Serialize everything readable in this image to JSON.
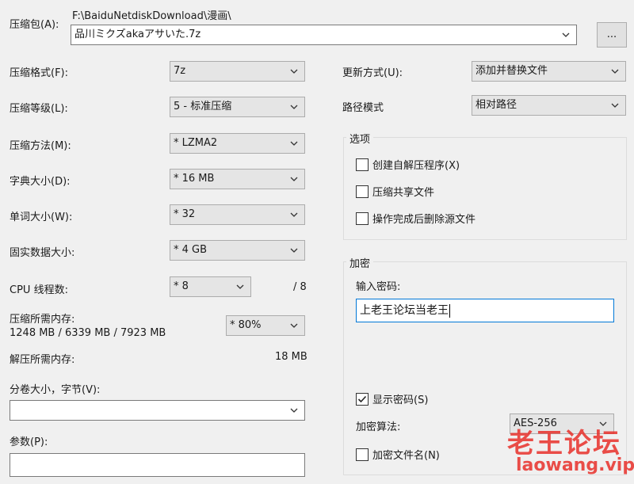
{
  "archive": {
    "label": "压缩包(A):",
    "path": "F:\\BaiduNetdiskDownload\\漫画\\",
    "filename": "品川ミクズakaアサいた.7z",
    "browse_label": "..."
  },
  "left": {
    "format_label": "压缩格式(F):",
    "format_value": "7z",
    "level_label": "压缩等级(L):",
    "level_value": "5 - 标准压缩",
    "method_label": "压缩方法(M):",
    "method_value": "* LZMA2",
    "dict_label": "字典大小(D):",
    "dict_value": "* 16 MB",
    "word_label": "单词大小(W):",
    "word_value": "* 32",
    "solid_label": "固实数据大小:",
    "solid_value": "* 4 GB",
    "threads_label": "CPU 线程数:",
    "threads_value": "* 8",
    "threads_max": "/ 8",
    "mem_comp_label": "压缩所需内存:",
    "mem_comp_value": "1248 MB / 6339 MB / 7923 MB",
    "mem_percent": "* 80%",
    "mem_decomp_label": "解压所需内存:",
    "mem_decomp_value": "18 MB",
    "split_label": "分卷大小，字节(V):",
    "split_value": "",
    "params_label": "参数(P):",
    "params_value": ""
  },
  "right": {
    "update_label": "更新方式(U):",
    "update_value": "添加并替换文件",
    "path_label": "路径模式",
    "path_value": "相对路径",
    "options_title": "选项",
    "options": [
      {
        "label": "创建自解压程序(X)",
        "checked": false
      },
      {
        "label": "压缩共享文件",
        "checked": false
      },
      {
        "label": "操作完成后删除源文件",
        "checked": false
      }
    ],
    "encryption_title": "加密",
    "password_label": "输入密码:",
    "password_value": "上老王论坛当老王",
    "show_password_label": "显示密码(S)",
    "show_password_checked": true,
    "algo_label": "加密算法:",
    "algo_value": "AES-256",
    "encrypt_names_label": "加密文件名(N)",
    "encrypt_names_checked": false
  },
  "watermark": {
    "line1": "老王论坛",
    "line2": "laowang.vip",
    "color": "#e8302a"
  },
  "icons": {
    "dropdown": "chevron-down-icon",
    "check": "checkmark-icon"
  }
}
